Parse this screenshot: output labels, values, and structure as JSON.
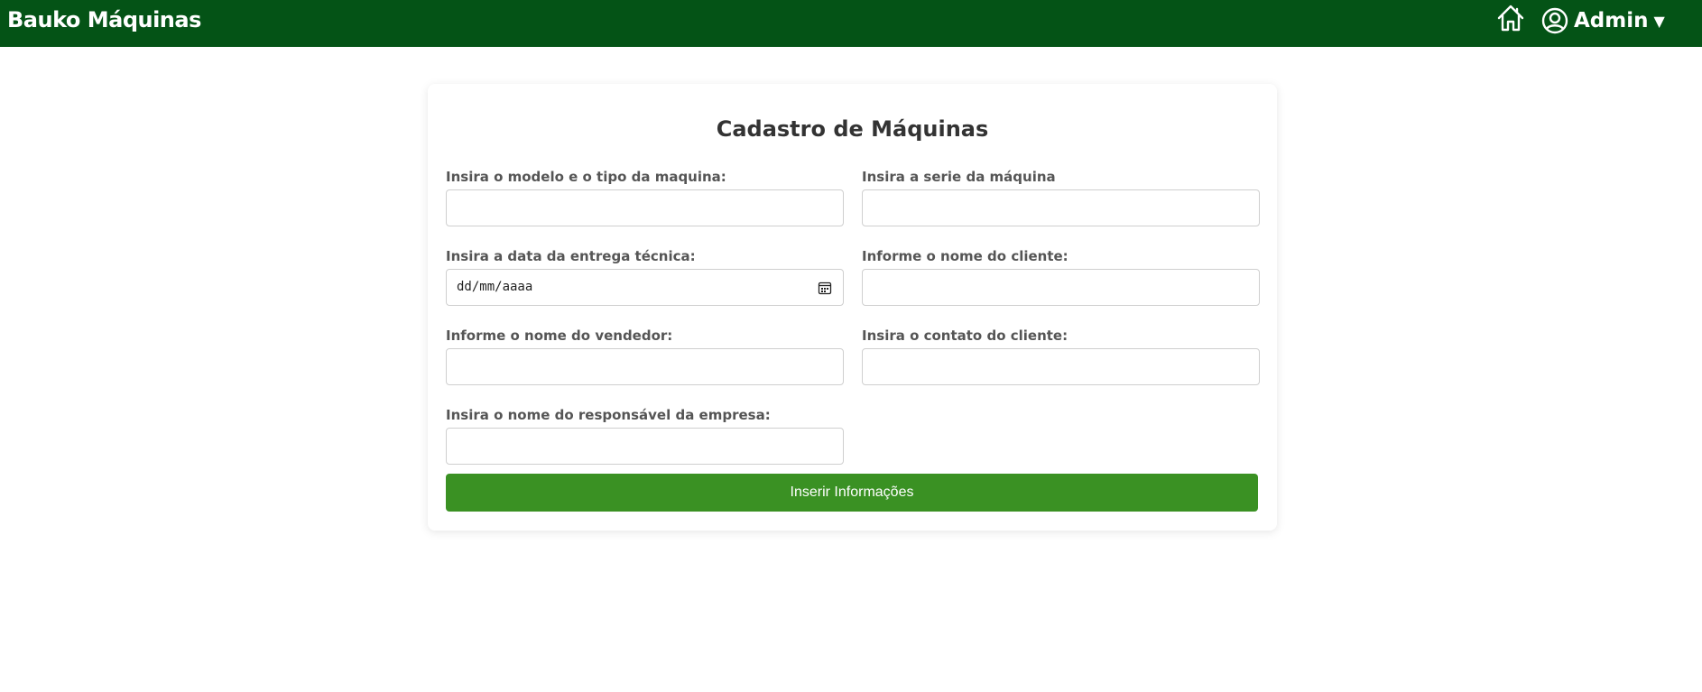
{
  "header": {
    "brand": "Bauko Máquinas",
    "home_icon": "home-icon",
    "user_icon": "user-circle-icon",
    "user_name": "Admin",
    "caret": "▼",
    "bg_color": "#045316"
  },
  "form": {
    "title": "Cadastro de Máquinas",
    "fields": [
      {
        "label": "Insira o modelo e o tipo da maquina:",
        "value": ""
      },
      {
        "label": "Insira a serie da máquina",
        "value": ""
      },
      {
        "label": "Insira a data da entrega técnica:",
        "value": "",
        "placeholder": "dd/mm/aaaa"
      },
      {
        "label": "Informe o nome do cliente:",
        "value": ""
      },
      {
        "label": "Informe o nome do vendedor:",
        "value": ""
      },
      {
        "label": "Insira o contato do cliente:",
        "value": ""
      },
      {
        "label": "Insira o nome do responsável da empresa:",
        "value": ""
      }
    ],
    "submit_label": "Inserir Informações",
    "submit_color": "#3a9123"
  }
}
